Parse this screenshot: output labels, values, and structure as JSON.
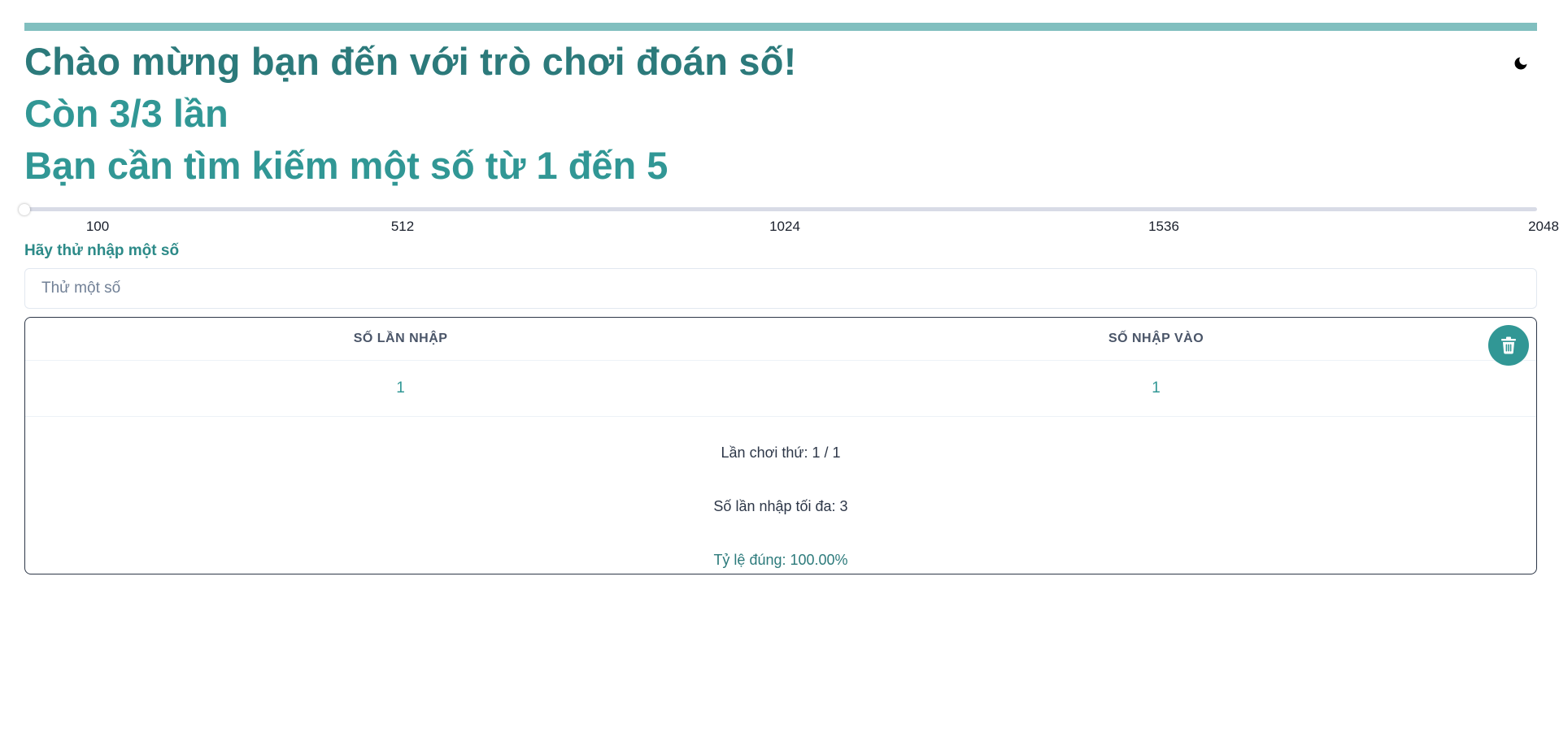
{
  "header": {
    "welcome_title": "Chào mừng bạn đến với trò chơi đoán số!",
    "attempts_left": "Còn 3/3 lần",
    "range_hint": "Bạn cần tìm kiếm một số từ 1 đến 5"
  },
  "theme_toggle": {
    "icon": "moon-icon"
  },
  "range_slider": {
    "value": 100,
    "min": 100,
    "max": 2048,
    "marks": [
      "100",
      "512",
      "1024",
      "1536",
      "2048"
    ]
  },
  "guess_input": {
    "label": "Hãy thử nhập một số",
    "placeholder": "Thử một số",
    "value": ""
  },
  "history": {
    "columns": [
      "Số lần nhập",
      "Số nhập vào"
    ],
    "rows": [
      {
        "attempt": "1",
        "value": "1"
      }
    ],
    "delete_icon": "trash-icon"
  },
  "stats": {
    "game_round": "Lần chơi thứ: 1 / 1",
    "max_attempts": "Số lần nhập tối đa: 3",
    "accuracy": "Tỷ lệ đúng: 100.00%"
  },
  "colors": {
    "accent": "#319795",
    "accent_dark": "#2c7a7b",
    "top_bar": "#81bfbf",
    "slider_track": "#d8dbe6"
  }
}
